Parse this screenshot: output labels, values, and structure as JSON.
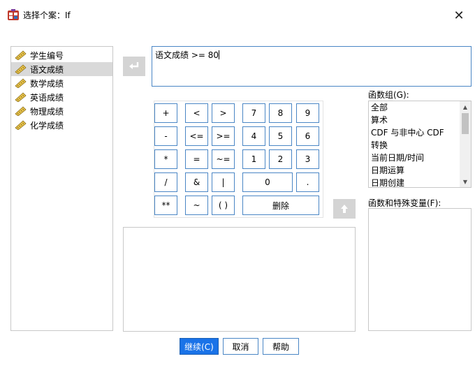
{
  "window": {
    "title": "选择个案：If",
    "close_glyph": "✕"
  },
  "variables": [
    {
      "label": "学生编号",
      "selected": false
    },
    {
      "label": "语文成绩",
      "selected": true
    },
    {
      "label": "数学成绩",
      "selected": false
    },
    {
      "label": "英语成绩",
      "selected": false
    },
    {
      "label": "物理成绩",
      "selected": false
    },
    {
      "label": "化学成绩",
      "selected": false
    }
  ],
  "expression": {
    "value": "语文成绩 >= 80"
  },
  "keypad": {
    "keys": [
      {
        "label": "+",
        "name": "plus"
      },
      {
        "label": "<",
        "name": "less-than"
      },
      {
        "label": ">",
        "name": "greater-than"
      },
      {
        "label": "7",
        "name": "7"
      },
      {
        "label": "8",
        "name": "8"
      },
      {
        "label": "9",
        "name": "9"
      },
      {
        "label": "-",
        "name": "minus"
      },
      {
        "label": "<=",
        "name": "less-equal"
      },
      {
        "label": ">=",
        "name": "greater-equal"
      },
      {
        "label": "4",
        "name": "4"
      },
      {
        "label": "5",
        "name": "5"
      },
      {
        "label": "6",
        "name": "6"
      },
      {
        "label": "*",
        "name": "multiply"
      },
      {
        "label": "=",
        "name": "equals"
      },
      {
        "label": "~=",
        "name": "not-equal"
      },
      {
        "label": "1",
        "name": "1"
      },
      {
        "label": "2",
        "name": "2"
      },
      {
        "label": "3",
        "name": "3"
      },
      {
        "label": "/",
        "name": "divide"
      },
      {
        "label": "&",
        "name": "and"
      },
      {
        "label": "|",
        "name": "or"
      },
      {
        "label": "0",
        "name": "0"
      },
      {
        "label": ".",
        "name": "decimal"
      },
      {
        "label": "**",
        "name": "power"
      },
      {
        "label": "~",
        "name": "not"
      },
      {
        "label": "( )",
        "name": "parentheses"
      },
      {
        "label": "删除",
        "name": "delete"
      }
    ]
  },
  "function_group": {
    "label": "函数组(G):",
    "items": [
      "全部",
      "算术",
      "CDF 与非中心 CDF",
      "转换",
      "当前日期/时间",
      "日期运算",
      "日期创建"
    ]
  },
  "functions_vars": {
    "label": "函数和特殊变量(F):"
  },
  "buttons": {
    "continue": "继续(C)",
    "cancel": "取消",
    "help": "帮助"
  },
  "colors": {
    "accent": "#1a73e8",
    "border_blue": "#4a86c5",
    "selection": "#d9d9d9"
  }
}
